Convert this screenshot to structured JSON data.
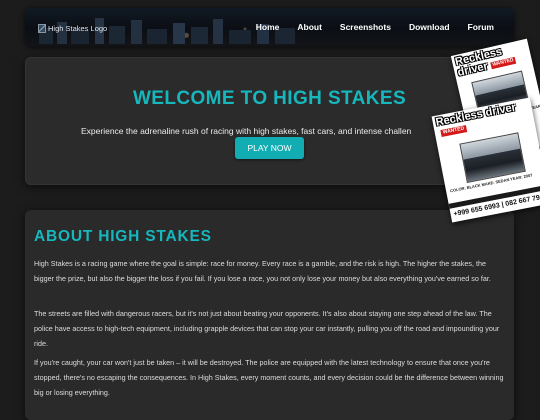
{
  "header": {
    "logo_alt": "High Stakes Logo",
    "nav": [
      "Home",
      "About",
      "Screenshots",
      "Download",
      "Forum"
    ]
  },
  "hero": {
    "title": "WELCOME TO HIGH STAKES",
    "tagline": "Experience the adrenaline rush of racing with high stakes, fast cars, and intense challen",
    "cta": "PLAY NOW"
  },
  "about": {
    "title": "ABOUT HIGH STAKES",
    "paragraphs": [
      "High Stakes is a racing game where the goal is simple: race for money. Every race is a gamble, and the risk is high. The higher the stakes, the bigger the prize, but also the bigger the loss if you fail. If you lose a race, you not only lose your money but also everything you've earned so far.",
      "The streets are filled with dangerous racers, but it's not just about beating your opponents. It's also about staying one step ahead of the law. The police have access to high-tech equipment, including grapple devices that can stop your car instantly, pulling you off the road and impounding your ride.",
      "If you're caught, your car won't just be taken – it will be destroyed. The police are equipped with the latest technology to ensure that once you're stopped, there's no escaping the consequences. In High Stakes, every moment counts, and every decision could be the difference between winning big or losing everything."
    ]
  },
  "posters": {
    "title": "Reckless driver",
    "badge": "WANTED",
    "info": "COLOR: BLACK MAKE: SEDAN YEAR: 2007",
    "phone": "+999 655 6993 | 082 667 79"
  },
  "colors": {
    "accent": "#16b7bd",
    "background": "#1c1c1c",
    "panel": "#2a2a2a"
  }
}
